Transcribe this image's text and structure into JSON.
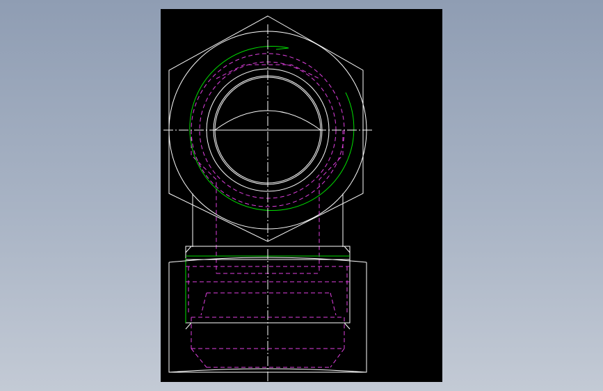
{
  "viewport": {
    "background_color": "#000000",
    "page_background": [
      "#8f9db3",
      "#c3cad5"
    ]
  },
  "colors": {
    "outline": "#ffffff",
    "thread": "#00e000",
    "hidden": "#e040e0",
    "centerline": "#ffffff"
  },
  "drawing": {
    "views": [
      "top-view",
      "front-view"
    ],
    "line_types": [
      "visible-edge",
      "thread-line",
      "hidden-line",
      "center-line"
    ]
  }
}
